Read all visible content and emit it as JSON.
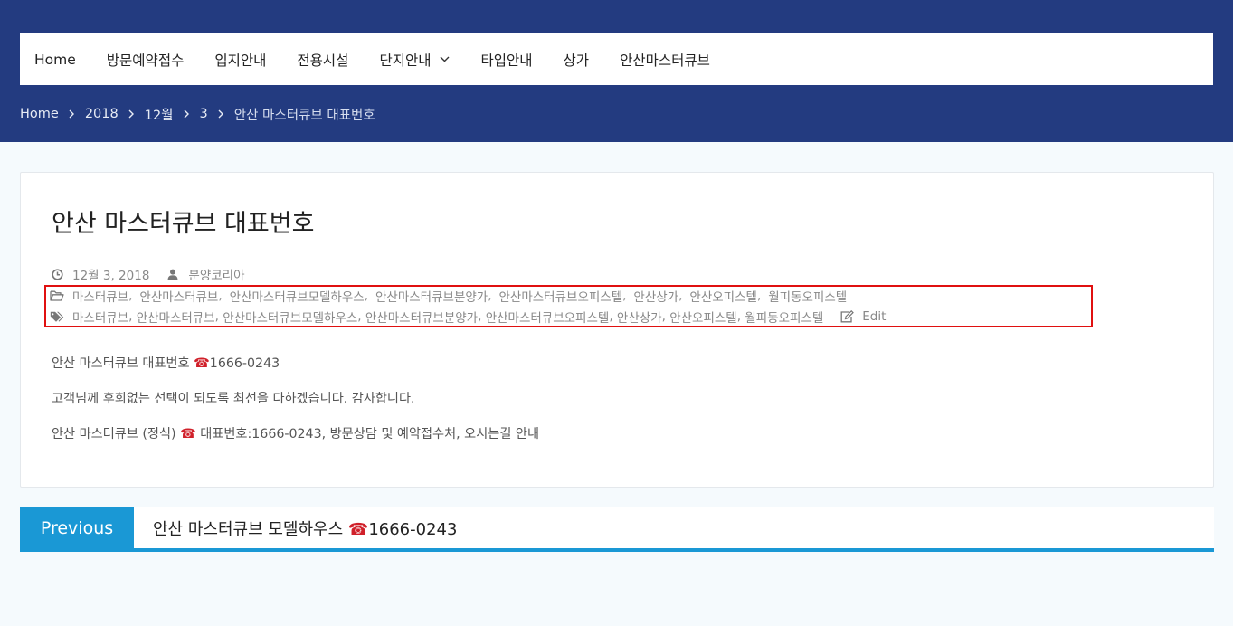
{
  "nav": {
    "items": [
      {
        "label": "Home"
      },
      {
        "label": "방문예약접수"
      },
      {
        "label": "입지안내"
      },
      {
        "label": "전용시설"
      },
      {
        "label": "단지안내"
      },
      {
        "label": "타입안내"
      },
      {
        "label": "상가"
      },
      {
        "label": "안산마스터큐브"
      }
    ]
  },
  "breadcrumb": {
    "items": [
      "Home",
      "2018",
      "12월",
      "3"
    ],
    "current": "안산 마스터큐브 대표번호"
  },
  "post": {
    "title": "안산 마스터큐브 대표번호",
    "date": "12월 3, 2018",
    "author": "분양코리아",
    "categories": [
      "마스터큐브",
      "안산마스터큐브",
      "안산마스터큐브모델하우스",
      "안산마스터큐브분양가",
      "안산마스터큐브오피스텔",
      "안산상가",
      "안산오피스텔",
      "월피동오피스텔"
    ],
    "tags": [
      "마스터큐브",
      "안산마스터큐브",
      "안산마스터큐브모델하우스",
      "안산마스터큐브분양가",
      "안산마스터큐브오피스텔",
      "안산상가",
      "안산오피스텔",
      "월피동오피스텔"
    ],
    "edit_label": "Edit",
    "content": {
      "p1_text": "안산 마스터큐브 대표번호 ",
      "p1_phone_icon": "☎",
      "p1_phone": "1666-0243",
      "p2": "고객님께 후회없는 선택이 되도록 최선을 다하겠습니다. 감사합니다.",
      "p3_before": "안산 마스터큐브 (정식) ",
      "p3_icon": "☎",
      "p3_after": " 대표번호:1666-0243, 방문상담 및 예약접수처, 오시는길 안내"
    }
  },
  "post_nav": {
    "previous_label": "Previous",
    "previous_title_text": "안산 마스터큐브 모델하우스 ",
    "previous_title_icon": "☎",
    "previous_title_phone": "1666-0243"
  },
  "colors": {
    "header_bg": "#233b80",
    "accent": "#1a98d5",
    "highlight": "#e01010",
    "phone_icon": "#d0202a"
  }
}
